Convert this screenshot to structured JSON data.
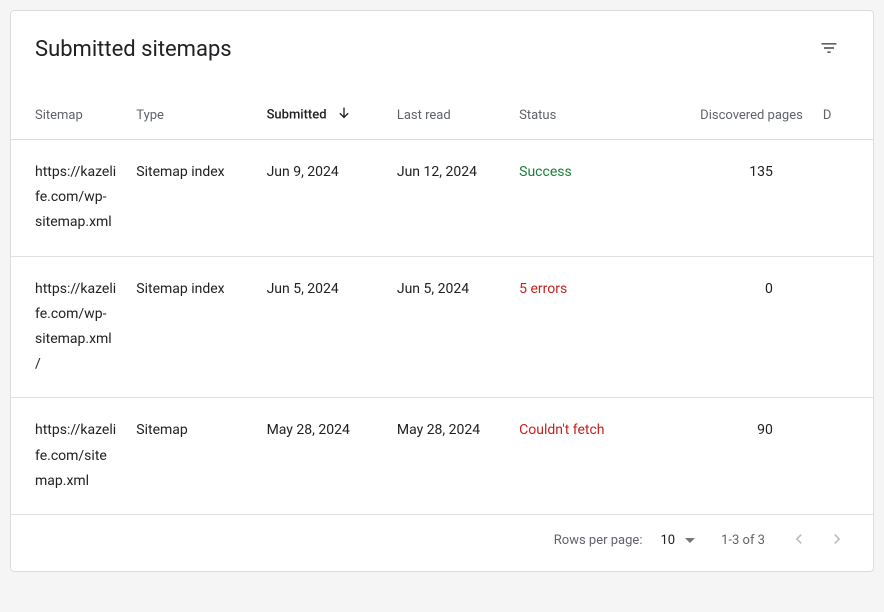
{
  "header": {
    "title": "Submitted sitemaps"
  },
  "columns": {
    "sitemap": "Sitemap",
    "type": "Type",
    "submitted": "Submitted",
    "last_read": "Last read",
    "status": "Status",
    "discovered": "Discovered pages",
    "extra": "D"
  },
  "rows": [
    {
      "sitemap": "https://kazelife.com/wp-sitemap.xml",
      "type": "Sitemap index",
      "submitted": "Jun 9, 2024",
      "last_read": "Jun 12, 2024",
      "status": "Success",
      "status_class": "status-success",
      "discovered": "135"
    },
    {
      "sitemap": "https://kazelife.com/wp-sitemap.xml/",
      "type": "Sitemap index",
      "submitted": "Jun 5, 2024",
      "last_read": "Jun 5, 2024",
      "status": "5 errors",
      "status_class": "status-error",
      "discovered": "0"
    },
    {
      "sitemap": "https://kazelife.com/sitemap.xml",
      "type": "Sitemap",
      "submitted": "May 28, 2024",
      "last_read": "May 28, 2024",
      "status": "Couldn't fetch",
      "status_class": "status-warn",
      "discovered": "90"
    }
  ],
  "pagination": {
    "rows_label": "Rows per page:",
    "page_size": "10",
    "range": "1-3 of 3"
  }
}
